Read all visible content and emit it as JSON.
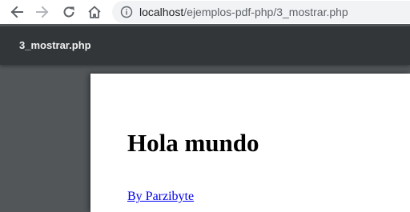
{
  "browser": {
    "address_bar": {
      "host": "localhost",
      "path": "/ejemplos-pdf-php/3_mostrar.php"
    },
    "icons": {
      "back": "arrow-left",
      "forward": "arrow-right",
      "reload": "reload",
      "home": "home",
      "site_info": "info-circle"
    }
  },
  "viewer": {
    "document_title": "3_mostrar.php"
  },
  "page": {
    "heading": "Hola mundo",
    "link_text": "By Parzibyte"
  },
  "colors": {
    "viewer_toolbar": "#323639",
    "viewer_background": "#525659",
    "link": "#0000ee"
  }
}
